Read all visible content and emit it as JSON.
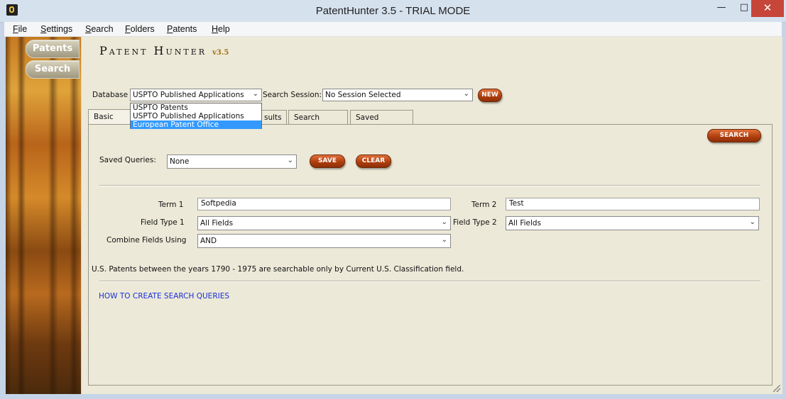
{
  "window": {
    "title": "PatentHunter 3.5 - TRIAL MODE"
  },
  "menu": {
    "items": [
      {
        "label": "File",
        "key": "F",
        "rest": "ile"
      },
      {
        "label": "Settings",
        "key": "S",
        "rest": "ettings"
      },
      {
        "label": "Search",
        "key": "S",
        "rest": "earch"
      },
      {
        "label": "Folders",
        "key": "F",
        "rest": "olders"
      },
      {
        "label": "Patents",
        "key": "P",
        "rest": "atents"
      },
      {
        "label": "Help",
        "key": "H",
        "rest": "elp"
      }
    ]
  },
  "sidebar": {
    "patents_label": "Patents",
    "search_label": "Search"
  },
  "logo": {
    "text": "Patent Hunter",
    "version": "v3.5"
  },
  "database": {
    "label": "Database",
    "value": "USPTO Published Applications",
    "options": [
      "USPTO Patents",
      "USPTO Published Applications",
      "European Patent Office"
    ],
    "highlighted": "European Patent Office"
  },
  "session": {
    "label": "Search Session:",
    "value": "No Session Selected",
    "new_label": "NEW"
  },
  "tabs": [
    {
      "label": "Basic Search"
    },
    {
      "label": "Results"
    },
    {
      "label": "Search Report"
    },
    {
      "label": "Saved Reports"
    }
  ],
  "visible_tab_text": {
    "basic": "Basic Sea",
    "results": "sults"
  },
  "actions": {
    "search_label": "SEARCH",
    "save_label": "SAVE",
    "clear_label": "CLEAR"
  },
  "saved_queries": {
    "label": "Saved Queries:",
    "value": "None"
  },
  "form": {
    "term1_label": "Term 1",
    "term1_value": "Softpedia",
    "term2_label": "Term 2",
    "term2_value": "Test",
    "field1_label": "Field Type 1",
    "field1_value": "All Fields",
    "field2_label": "Field Type 2",
    "field2_value": "All Fields",
    "combine_label": "Combine Fields Using",
    "combine_value": "AND"
  },
  "note": "U.S. Patents between the years 1790 - 1975 are searchable only by Current U.S. Classification field.",
  "help_link": "HOW TO CREATE SEARCH QUERIES",
  "colors": {
    "accent_button": "#b0400f",
    "link": "#1a2fd8",
    "highlight": "#3399ff",
    "panel": "#ece9d8"
  }
}
